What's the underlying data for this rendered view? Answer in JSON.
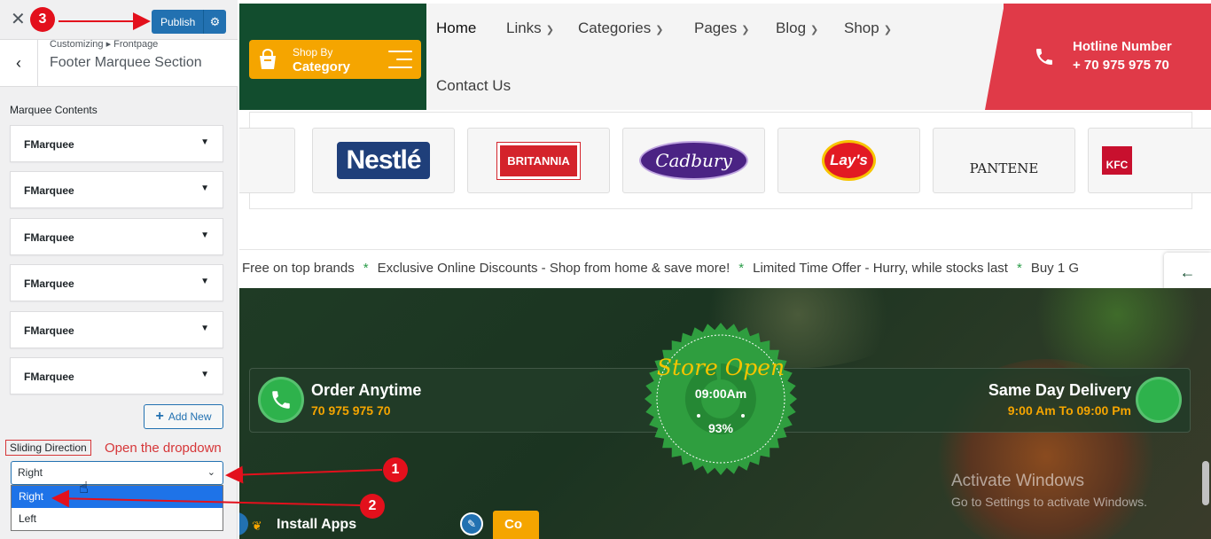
{
  "customizer": {
    "close_icon": "close-icon",
    "publish_label": "Publish",
    "breadcrumb": "Customizing ▸ Frontpage",
    "section_title": "Footer Marquee Section",
    "marquee_contents_label": "Marquee Contents",
    "marquee_items": [
      "FMarquee",
      "FMarquee",
      "FMarquee",
      "FMarquee",
      "FMarquee",
      "FMarquee"
    ],
    "add_new_label": "Add New",
    "sliding_direction_label": "Sliding Direction",
    "sliding_direction_value": "Right",
    "sliding_direction_options": [
      "Right",
      "Left"
    ]
  },
  "annotations": {
    "step1": "1",
    "step2": "2",
    "step3": "3",
    "note": "Open the dropdown",
    "accent": "#e3101c"
  },
  "site": {
    "shop_by_small": "Shop By",
    "shop_by_big": "Category",
    "nav": [
      "Home",
      "Links",
      "Categories",
      "Pages",
      "Blog",
      "Shop",
      "Contact Us"
    ],
    "hotline_title": "Hotline Number",
    "hotline_number": "+ 70 975 975 70",
    "brands": [
      "Nestlé",
      "BRITANNIA",
      "Cadbury",
      "Lay's",
      "PANTENE",
      "KFC"
    ],
    "marquee": [
      "Free on top brands",
      "Exclusive Online Discounts - Shop from home & save more!",
      "Limited Time Offer - Hurry, while stocks last",
      "Buy 1 G"
    ],
    "order_title": "Order Anytime",
    "order_phone": "70 975 975 70",
    "store_open": "Store Open",
    "open_time": "09:00Am",
    "progress_percent": "93%",
    "progress_value": 0.93,
    "delivery_title": "Same Day Delivery",
    "delivery_hours": "9:00 Am To 09:00 Pm",
    "install_apps": "Install Apps",
    "co_label": "Co",
    "activate_title": "Activate Windows",
    "activate_sub": "Go to Settings to activate Windows."
  },
  "colors": {
    "brand_green": "#124d2e",
    "accent_orange": "#f5a500",
    "hotline_red": "#e03a48",
    "wp_blue": "#2271b1"
  }
}
